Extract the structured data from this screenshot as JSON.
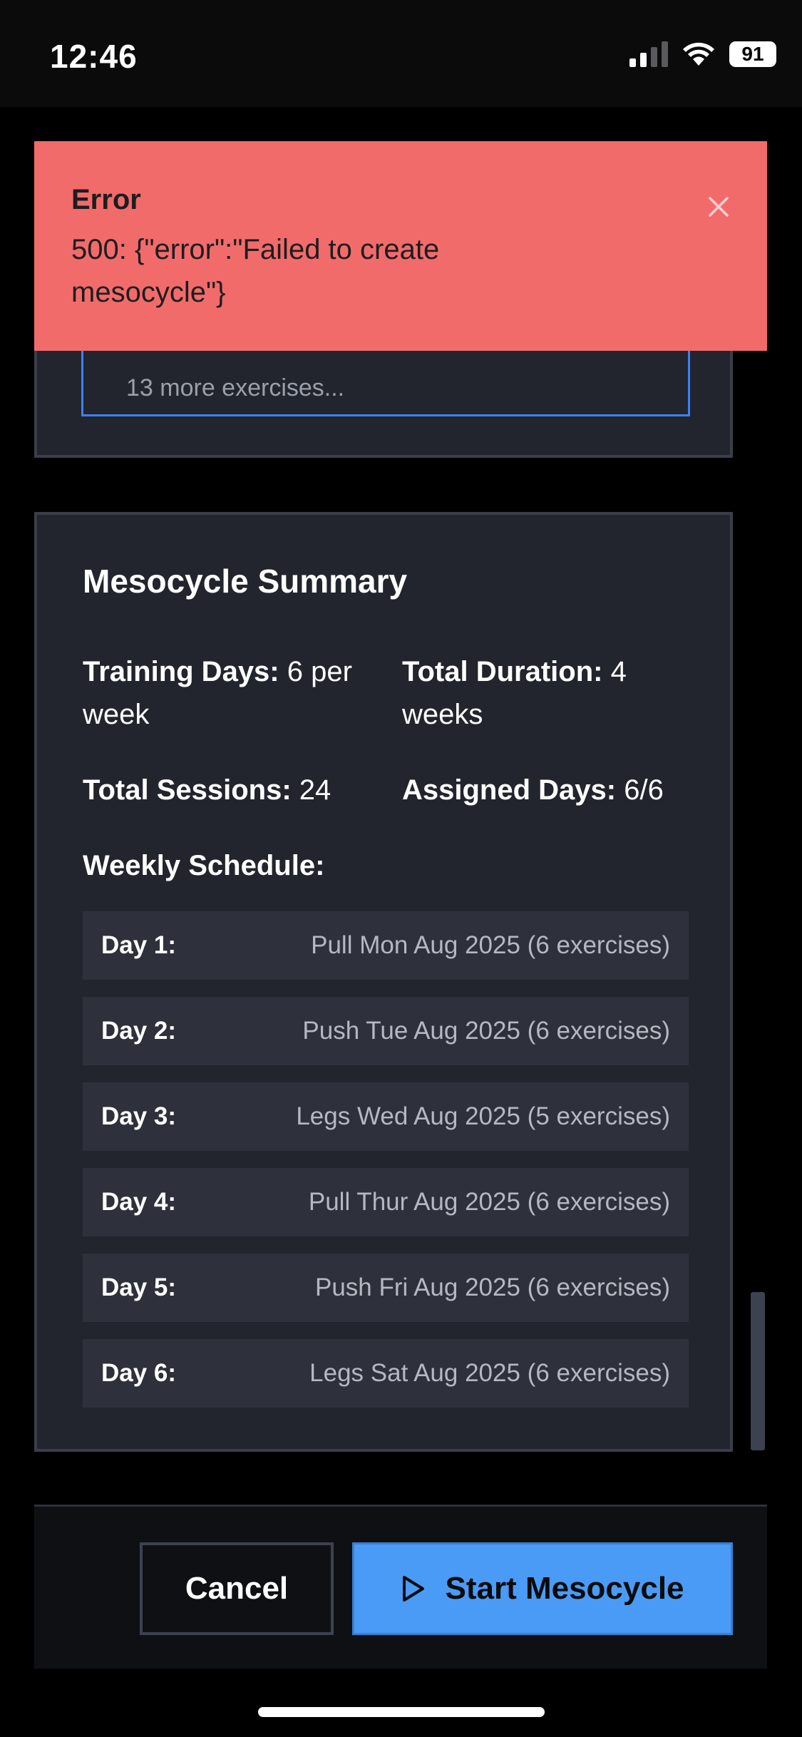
{
  "status_bar": {
    "time": "12:46",
    "battery": "91",
    "signal_icon": "cellular-signal-icon",
    "wifi_icon": "wifi-icon",
    "battery_icon": "battery-icon"
  },
  "exercises_card": {
    "more_text": "13 more exercises..."
  },
  "error_toast": {
    "title": "Error",
    "message": "500: {\"error\":\"Failed to create mesocycle\"}",
    "close_icon": "close-icon",
    "color": "#f26b6b"
  },
  "summary": {
    "title": "Mesocycle Summary",
    "training_days_label": "Training Days:",
    "training_days_value": " 6 per week",
    "total_duration_label": "Total Duration:",
    "total_duration_value": " 4 weeks",
    "total_sessions_label": "Total Sessions:",
    "total_sessions_value": " 24",
    "assigned_days_label": "Assigned Days:",
    "assigned_days_value": " 6/6",
    "weekly_title": "Weekly Schedule:",
    "schedule": [
      {
        "day": "Day 1:",
        "desc": "Pull Mon Aug 2025 (6 exercises)"
      },
      {
        "day": "Day 2:",
        "desc": "Push Tue Aug 2025 (6 exercises)"
      },
      {
        "day": "Day 3:",
        "desc": "Legs Wed Aug 2025 (5 exercises)"
      },
      {
        "day": "Day 4:",
        "desc": "Pull Thur Aug 2025 (6 exercises)"
      },
      {
        "day": "Day 5:",
        "desc": "Push Fri Aug 2025 (6 exercises)"
      },
      {
        "day": "Day 6:",
        "desc": "Legs Sat Aug 2025 (6 exercises)"
      }
    ]
  },
  "footer": {
    "cancel_label": "Cancel",
    "start_label": "Start Mesocycle",
    "start_icon": "play-icon",
    "accent_color": "#4a9bf5"
  }
}
